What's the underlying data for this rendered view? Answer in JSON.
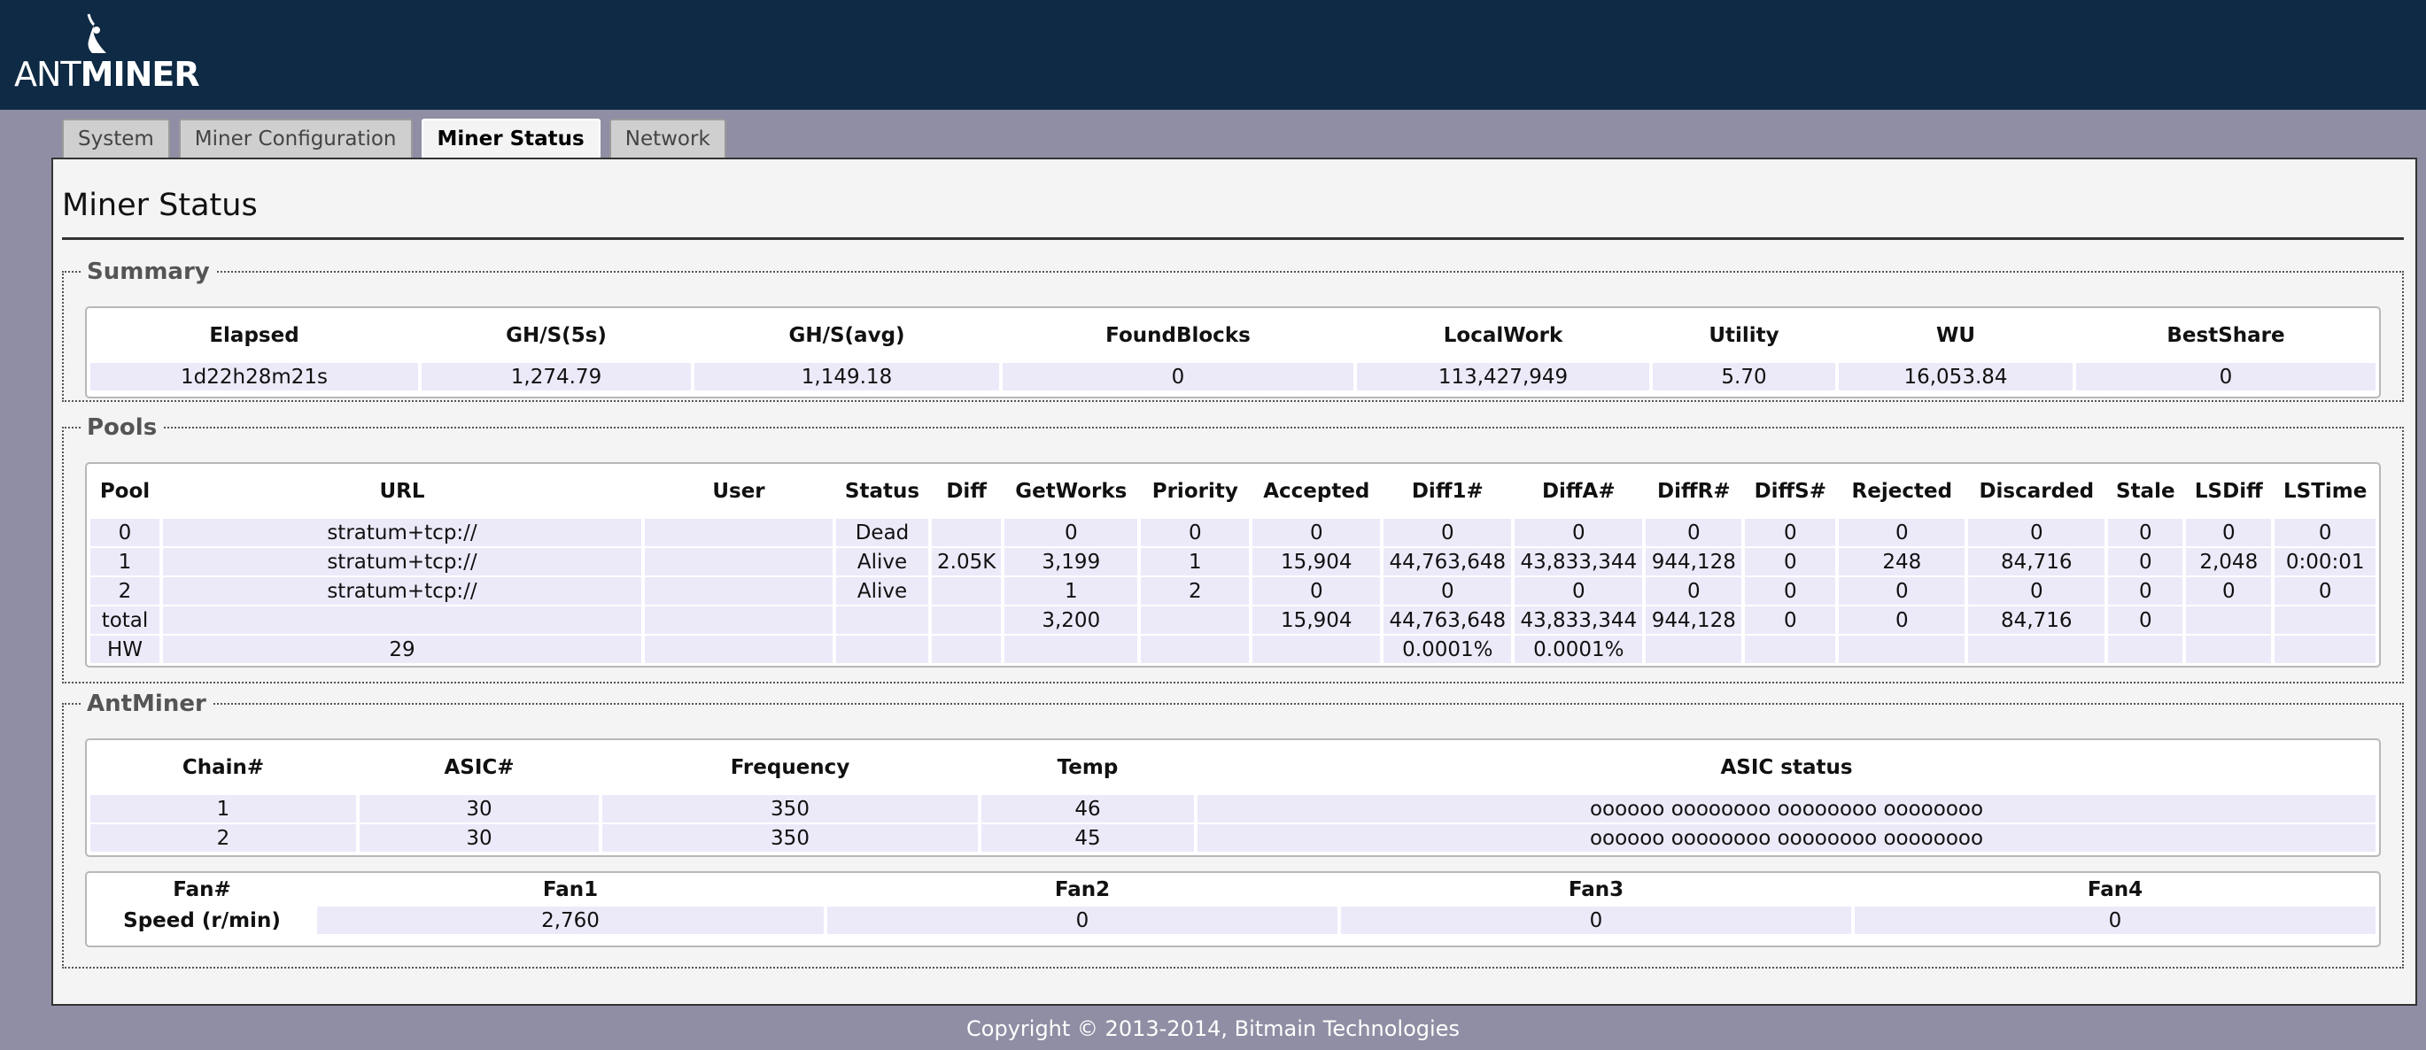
{
  "brand": {
    "logo_text_light": "ANT",
    "logo_text_bold": "MINER"
  },
  "tabs": [
    {
      "label": "System",
      "active": false
    },
    {
      "label": "Miner Configuration",
      "active": false
    },
    {
      "label": "Miner Status",
      "active": true
    },
    {
      "label": "Network",
      "active": false
    }
  ],
  "page_title": "Miner Status",
  "summary": {
    "legend": "Summary",
    "headers": [
      "Elapsed",
      "GH/S(5s)",
      "GH/S(avg)",
      "FoundBlocks",
      "LocalWork",
      "Utility",
      "WU",
      "BestShare"
    ],
    "values": [
      "1d22h28m21s",
      "1,274.79",
      "1,149.18",
      "0",
      "113,427,949",
      "5.70",
      "16,053.84",
      "0"
    ]
  },
  "pools": {
    "legend": "Pools",
    "headers": [
      "Pool",
      "URL",
      "User",
      "Status",
      "Diff",
      "GetWorks",
      "Priority",
      "Accepted",
      "Diff1#",
      "DiffA#",
      "DiffR#",
      "DiffS#",
      "Rejected",
      "Discarded",
      "Stale",
      "LSDiff",
      "LSTime"
    ],
    "rows": [
      [
        "0",
        "stratum+tcp://",
        "",
        "Dead",
        "",
        "0",
        "0",
        "0",
        "0",
        "0",
        "0",
        "0",
        "0",
        "0",
        "0",
        "0",
        "0"
      ],
      [
        "1",
        "stratum+tcp://",
        "",
        "Alive",
        "2.05K",
        "3,199",
        "1",
        "15,904",
        "44,763,648",
        "43,833,344",
        "944,128",
        "0",
        "248",
        "84,716",
        "0",
        "2,048",
        "0:00:01"
      ],
      [
        "2",
        "stratum+tcp://",
        "",
        "Alive",
        "",
        "1",
        "2",
        "0",
        "0",
        "0",
        "0",
        "0",
        "0",
        "0",
        "0",
        "0",
        "0"
      ],
      [
        "total",
        "",
        "",
        "",
        "",
        "3,200",
        "",
        "15,904",
        "44,763,648",
        "43,833,344",
        "944,128",
        "0",
        "0",
        "84,716",
        "0",
        "",
        ""
      ],
      [
        "HW",
        "29",
        "",
        "",
        "",
        "",
        "",
        "",
        "0.0001%",
        "0.0001%",
        "",
        "",
        "",
        "",
        "",
        "",
        ""
      ]
    ]
  },
  "antminer": {
    "legend": "AntMiner",
    "chain_headers": [
      "Chain#",
      "ASIC#",
      "Frequency",
      "Temp",
      "ASIC status"
    ],
    "chains": [
      [
        "1",
        "30",
        "350",
        "46",
        "oooooo oooooooo oooooooo oooooooo"
      ],
      [
        "2",
        "30",
        "350",
        "45",
        "oooooo oooooooo oooooooo oooooooo"
      ]
    ],
    "fan_headers": [
      "Fan#",
      "Fan1",
      "Fan2",
      "Fan3",
      "Fan4"
    ],
    "fan_row_label": "Speed (r/min)",
    "fan_speeds": [
      "2,760",
      "0",
      "0",
      "0"
    ]
  },
  "footer": "Copyright © 2013-2014, Bitmain Technologies"
}
